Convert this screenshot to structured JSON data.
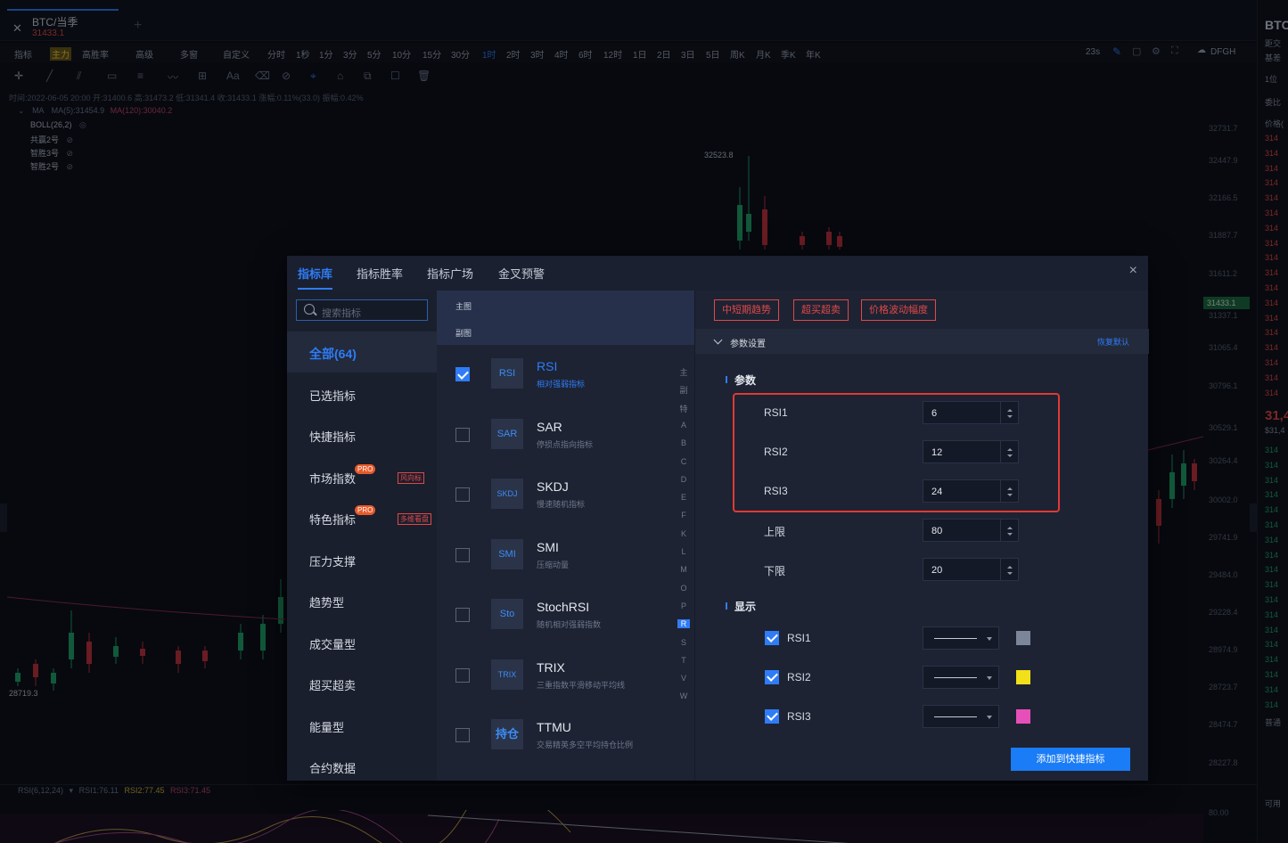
{
  "tab": {
    "name": "BTC/当季",
    "price": "31433.1"
  },
  "toolbar": {
    "items": [
      "指标",
      "主力",
      "高胜率",
      "高级",
      "多窗",
      "自定义",
      "分时",
      "1秒",
      "1分",
      "3分",
      "5分",
      "10分",
      "15分",
      "30分",
      "1时",
      "2时",
      "3时",
      "4时",
      "6时",
      "12时",
      "1日",
      "2日",
      "3日",
      "5日",
      "周K",
      "月K",
      "季K",
      "年K"
    ],
    "active": "1时",
    "timer": "23s",
    "user": "DFGH"
  },
  "info_line": "时间:2022-06-05 20:00  开:31400.6  高:31473.2  低:31341.4  收:31433.1  涨幅:0.11%(33.0)  振幅:0.42%",
  "ma_line": {
    "label": "MA",
    "ma5": "MA(5):31454.9",
    "ma120": "MA(120):30040.2"
  },
  "overlays": [
    "BOLL(26,2)",
    "共赢2号",
    "智胜3号",
    "智胜2号"
  ],
  "chart_labels": {
    "high": "32523.8",
    "low": "28719.3"
  },
  "price_axis": [
    "32731.7",
    "32447.9",
    "32166.5",
    "31887.7",
    "31611.2",
    "31337.1",
    "31065.4",
    "30796.1",
    "30529.1",
    "30264.4",
    "30002.0",
    "29741.9",
    "29484.0",
    "29228.4",
    "28974.9",
    "28723.7",
    "28474.7",
    "28227.8",
    "80.00"
  ],
  "last_price": "31433.1",
  "rsi_line": {
    "label": "RSI(6,12,24)",
    "rsi1": "RSI1:76.11",
    "rsi2": "RSI2:77.45",
    "rsi3": "RSI3:71.45"
  },
  "right_panel": {
    "title": "BTC",
    "l1": "距交",
    "l2": "基差",
    "l3": "1位",
    "l4": "委比",
    "l5": "价格(",
    "big": "31,4",
    "sub": "$31,4",
    "footer": "普通",
    "footer2": "可用"
  },
  "modal": {
    "tabs": [
      "指标库",
      "指标胜率",
      "指标广场",
      "金叉预警"
    ],
    "close": "×",
    "search_placeholder": "搜索指标",
    "nav": [
      {
        "label": "全部(64)"
      },
      {
        "label": "已选指标"
      },
      {
        "label": "快捷指标"
      },
      {
        "label": "市场指数",
        "badge": "PRO",
        "tag": "风向标"
      },
      {
        "label": "特色指标",
        "badge": "PRO",
        "tag": "多维看盘"
      },
      {
        "label": "压力支撑"
      },
      {
        "label": "趋势型"
      },
      {
        "label": "成交量型"
      },
      {
        "label": "超买超卖"
      },
      {
        "label": "能量型"
      },
      {
        "label": "合约数据"
      }
    ],
    "sections": [
      "主图",
      "副图"
    ],
    "indicators": [
      {
        "icon": "RSI",
        "name": "RSI",
        "desc": "相对强弱指标",
        "checked": true
      },
      {
        "icon": "SAR",
        "name": "SAR",
        "desc": "停损点指向指标",
        "checked": false
      },
      {
        "icon": "SKDJ",
        "name": "SKDJ",
        "desc": "慢速随机指标",
        "checked": false
      },
      {
        "icon": "SMI",
        "name": "SMI",
        "desc": "压缩动量",
        "checked": false
      },
      {
        "icon": "Sto",
        "name": "StochRSI",
        "desc": "随机相对强弱指数",
        "checked": false
      },
      {
        "icon": "TRIX",
        "name": "TRIX",
        "desc": "三重指数平滑移动平均线",
        "checked": false
      },
      {
        "icon": "持仓",
        "name": "TTMU",
        "desc": "交易精英多空平均持仓比例",
        "checked": false
      }
    ],
    "letters": [
      "主",
      "副",
      "特",
      "A",
      "B",
      "C",
      "D",
      "E",
      "F",
      "K",
      "L",
      "M",
      "O",
      "P",
      "R",
      "S",
      "T",
      "V",
      "W"
    ],
    "letter_active": "R",
    "chips": [
      "中短期趋势",
      "超买超卖",
      "价格波动幅度"
    ],
    "params_header": "参数设置",
    "restore": "恢复默认",
    "params_title": "参数",
    "params": [
      {
        "label": "RSI1",
        "value": "6"
      },
      {
        "label": "RSI2",
        "value": "12"
      },
      {
        "label": "RSI3",
        "value": "24"
      },
      {
        "label": "上限",
        "value": "80"
      },
      {
        "label": "下限",
        "value": "20"
      }
    ],
    "display_title": "显示",
    "display": [
      {
        "label": "RSI1",
        "color": "#7d8598"
      },
      {
        "label": "RSI2",
        "color": "#f2e01a"
      },
      {
        "label": "RSI3",
        "color": "#e64fb8"
      }
    ],
    "add_button": "添加到快捷指标"
  }
}
